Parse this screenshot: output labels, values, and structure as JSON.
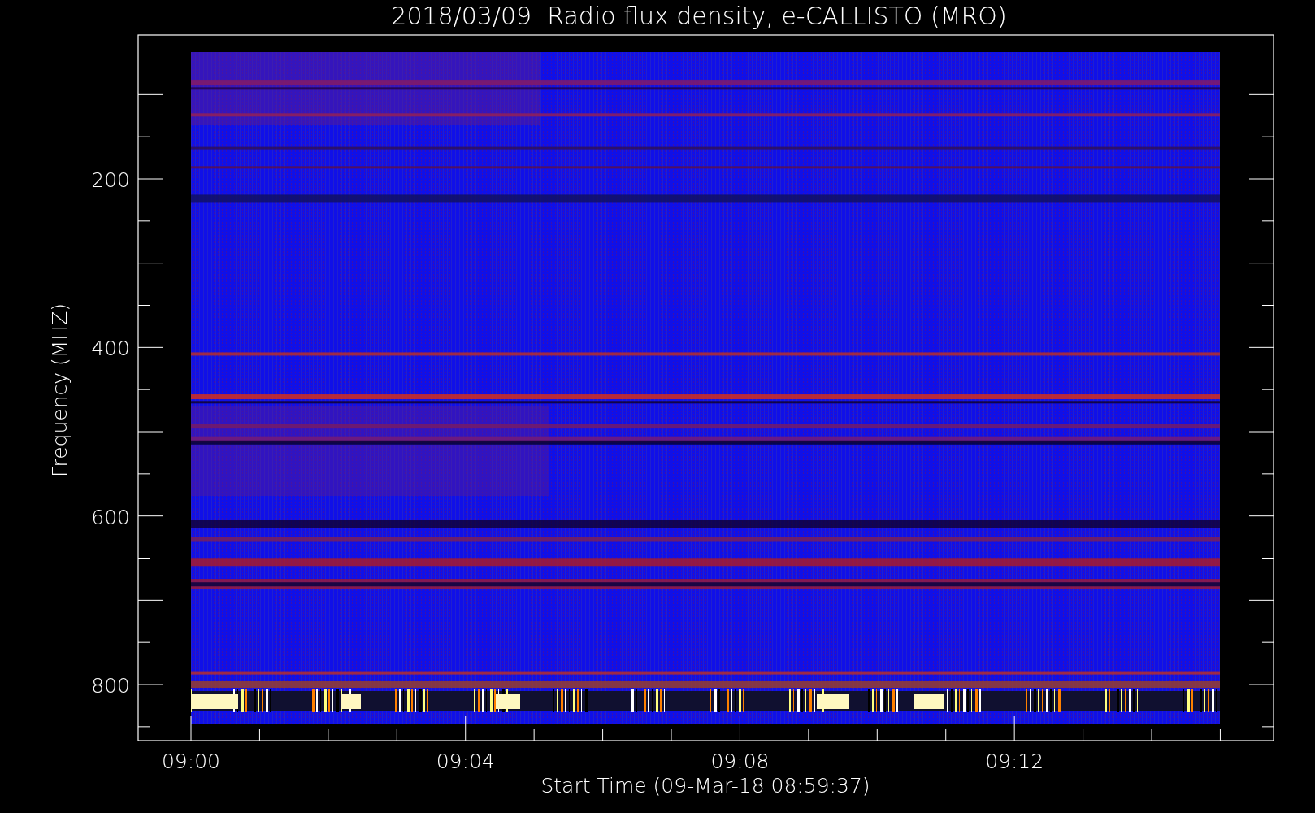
{
  "title": "2018/03/09  Radio flux density, e-CALLISTO (MRO)",
  "y_axis": {
    "label": "Frequency (MHZ)",
    "ticks": [
      "200",
      "400",
      "600",
      "800"
    ]
  },
  "x_axis": {
    "label": "Start Time (09-Mar-18 08:59:37)",
    "ticks": [
      "09:00",
      "09:04",
      "09:08",
      "09:12"
    ]
  }
}
